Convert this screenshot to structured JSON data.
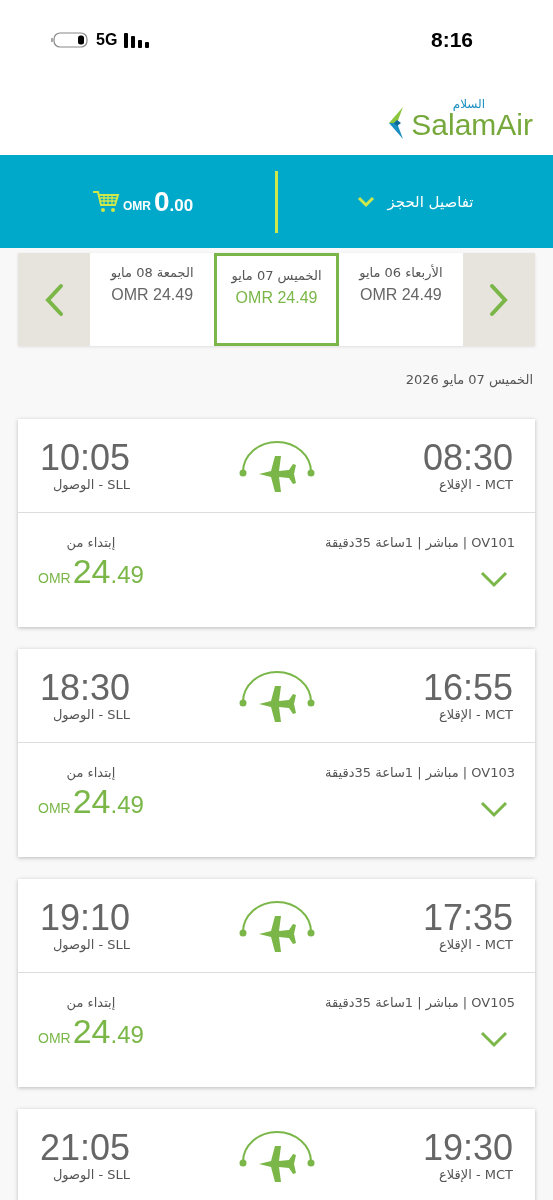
{
  "status_bar": {
    "network": "5G",
    "time": "8:16"
  },
  "logo": {
    "name": "SalamAir",
    "arabic": "السلام"
  },
  "booking_bar": {
    "details_label": "تفاصيل الحجز",
    "total_whole": "0",
    "total_fraction": ".00",
    "currency": "OMR"
  },
  "date_strip": {
    "days": [
      {
        "label": "الأربعاء 06 مايو",
        "price": "OMR 24.49",
        "selected": false
      },
      {
        "label": "الخميس 07 مايو",
        "price": "OMR 24.49",
        "selected": true
      },
      {
        "label": "الجمعة 08 مايو",
        "price": "OMR 24.49",
        "selected": false
      }
    ]
  },
  "selected_date": "الخميس 07 مايو 2026",
  "flights": [
    {
      "departure_time": "08:30",
      "departure_label": "MCT - الإقلاع",
      "arrival_time": "10:05",
      "arrival_label": "SLL - الوصول",
      "info": "OV101 | مباشر | 1ساعة 35دقيقة",
      "from_label": "إبتداء من",
      "currency": "OMR",
      "price_whole": "24",
      "price_fraction": ".49"
    },
    {
      "departure_time": "16:55",
      "departure_label": "MCT - الإقلاع",
      "arrival_time": "18:30",
      "arrival_label": "SLL - الوصول",
      "info": "OV103 | مباشر | 1ساعة 35دقيقة",
      "from_label": "إبتداء من",
      "currency": "OMR",
      "price_whole": "24",
      "price_fraction": ".49"
    },
    {
      "departure_time": "17:35",
      "departure_label": "MCT - الإقلاع",
      "arrival_time": "19:10",
      "arrival_label": "SLL - الوصول",
      "info": "OV105 | مباشر | 1ساعة 35دقيقة",
      "from_label": "إبتداء من",
      "currency": "OMR",
      "price_whole": "24",
      "price_fraction": ".49"
    },
    {
      "departure_time": "19:30",
      "departure_label": "MCT - الإقلاع",
      "arrival_time": "21:05",
      "arrival_label": "SLL - الوصول"
    }
  ]
}
